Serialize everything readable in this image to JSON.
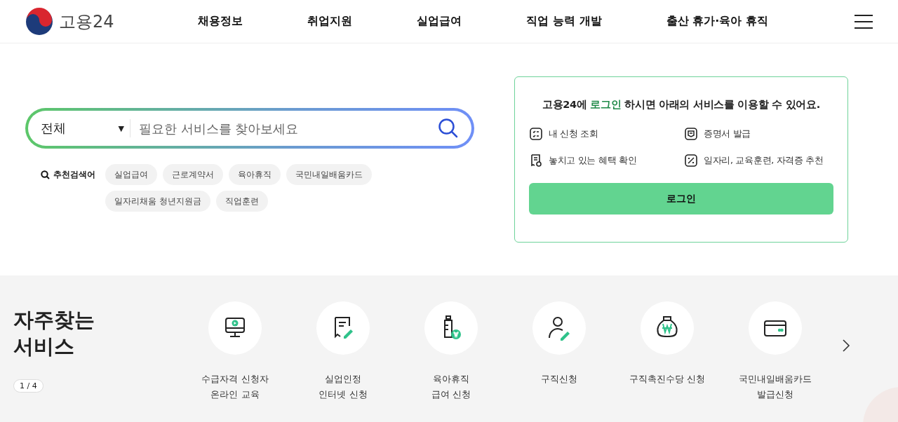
{
  "header": {
    "logo_text": "고용24",
    "nav": [
      "채용정보",
      "취업지원",
      "실업급여",
      "직업 능력 개발",
      "출산 휴가·육아 휴직"
    ]
  },
  "search": {
    "scope": "전체",
    "scope_caret": "▼",
    "placeholder": "필요한 서비스를 찾아보세요",
    "recommend_label": "추천검색어",
    "keywords": [
      "실업급여",
      "근로계약서",
      "육아휴직",
      "국민내일배움카드",
      "일자리채움 청년지원금",
      "직업훈련"
    ]
  },
  "login_card": {
    "heading": "고용24에 **로그인** 하시면 아래의 서비스를 이용할 수 있어요.",
    "features": [
      "내 신청 조회",
      "증명서 발급",
      "놓치고 있는 혜택 확인",
      "일자리, 교육훈련, 자격증 추천"
    ],
    "button": "로그인"
  },
  "services": {
    "title": "자주찾는\n서비스",
    "pager": "1 / 4",
    "items": [
      {
        "label": "수급자격 신청자\n온라인 교육"
      },
      {
        "label": "실업인정\n인터넷 신청"
      },
      {
        "label": "육아휴직\n급여 신청"
      },
      {
        "label": "구직신청"
      },
      {
        "label": "구직촉진수당 신청"
      },
      {
        "label": "국민내일배움카드\n발급신청"
      }
    ]
  }
}
